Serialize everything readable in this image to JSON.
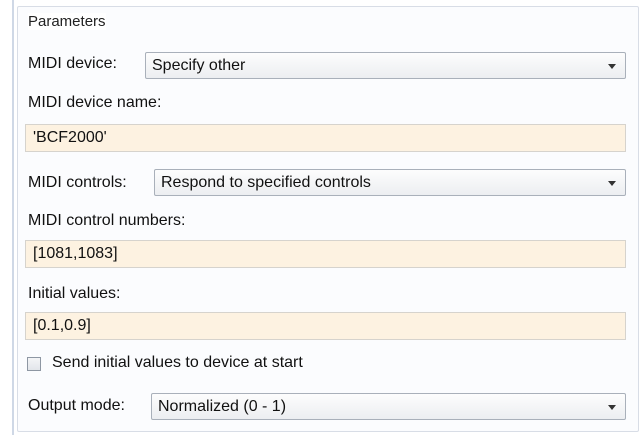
{
  "parameters": {
    "title": "Parameters",
    "midi_device": {
      "label": "MIDI device:",
      "value": "Specify other"
    },
    "midi_device_name": {
      "label": "MIDI device name:",
      "value": "'BCF2000'"
    },
    "midi_controls": {
      "label": "MIDI controls:",
      "value": "Respond to specified controls"
    },
    "midi_control_numbers": {
      "label": "MIDI control numbers:",
      "value": "[1081,1083]"
    },
    "initial_values": {
      "label": "Initial values:",
      "value": "[0.1,0.9]"
    },
    "send_initial": {
      "label": "Send initial values to device at start",
      "checked": false
    },
    "output_mode": {
      "label": "Output mode:",
      "value": "Normalized (0 - 1)"
    }
  },
  "colors": {
    "edit_background": "#fdf2e1",
    "group_border": "#d8dde6"
  },
  "icons": {
    "dropdown": "chevron-down-icon",
    "checkbox": "checkbox-unchecked"
  }
}
